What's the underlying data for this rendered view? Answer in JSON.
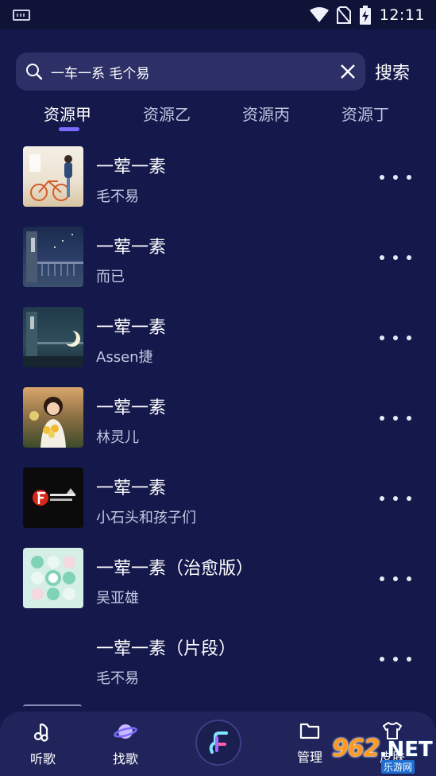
{
  "status_bar": {
    "time": "12:11"
  },
  "search": {
    "query": "一车一系 毛个易",
    "submit_label": "搜索"
  },
  "tabs": [
    {
      "label": "资源甲",
      "active": true
    },
    {
      "label": "资源乙",
      "active": false
    },
    {
      "label": "资源丙",
      "active": false
    },
    {
      "label": "资源丁",
      "active": false
    }
  ],
  "songs": [
    {
      "title": "一荤一素",
      "artist": "毛不易",
      "cover": "cover-bicycle-girl"
    },
    {
      "title": "一荤一素",
      "artist": "而已",
      "cover": "cover-night-balcony"
    },
    {
      "title": "一荤一素",
      "artist": "Assen捷",
      "cover": "cover-moon-balcony"
    },
    {
      "title": "一荤一素",
      "artist": "林灵儿",
      "cover": "cover-girl-flowers"
    },
    {
      "title": "一荤一素",
      "artist": "小石头和孩子们",
      "cover": "cover-logo-black"
    },
    {
      "title": "一荤一素（治愈版）",
      "artist": "吴亚雄",
      "cover": "cover-dots-mint"
    },
    {
      "title": "一荤一素（片段）",
      "artist": "毛不易",
      "cover": ""
    }
  ],
  "bottom_nav": {
    "listen_label": "听歌",
    "find_label": "找歌",
    "manage_label": "管理",
    "skin_label": "皮肤"
  },
  "watermark": {
    "number": "962",
    "net": ".NET",
    "sub": "乐游网"
  },
  "colors": {
    "background": "#14184a",
    "accent": "#7b6cff",
    "search_box": "#2c3066",
    "nav": "#20245a"
  }
}
